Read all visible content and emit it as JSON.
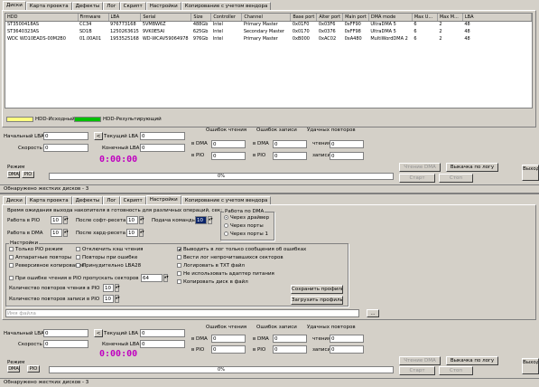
{
  "top": {
    "tabs": [
      "Диски",
      "Карта проекта",
      "Дефекты",
      "Лог",
      "Скрипт",
      "Настройки",
      "Копирование с учетом вендора"
    ],
    "table": {
      "headers": [
        "HDD",
        "Firmware",
        "LBA",
        "Serial",
        "Size",
        "Controller",
        "Channel",
        "Base port",
        "Alter port",
        "Main port",
        "DMA mode",
        "Max U...",
        "Max M...",
        "LBA"
      ],
      "rows": [
        [
          "ST3500418AS",
          "CC34",
          "976773168",
          "5VMBW6Z",
          "488Gb",
          "Intel",
          "Primary Master",
          "0x01F0",
          "0x03F6",
          "0xFF90",
          "UltraDMA 5",
          "6",
          "2",
          "48"
        ],
        [
          "ST3640323AS",
          "SD1B",
          "1250263615",
          "9VK0E5AI",
          "625Gb",
          "Intel",
          "Secondary Master",
          "0x0170",
          "0x0376",
          "0xFF98",
          "UltraDMA 5",
          "6",
          "2",
          "48"
        ],
        [
          "WDC WD10EADS-00M2B0",
          "01.00A01",
          "1953525168",
          "WD-WCAV59064978",
          "976Gb",
          "Intel",
          "Primary Master",
          "0xB000",
          "0xAC02",
          "0xA480",
          "MultiWordDMA 2",
          "6",
          "2",
          "48"
        ]
      ]
    },
    "legend": {
      "source": "HDD-Исходный",
      "result": "HDD-Результирующий",
      "source_color": "#ffff80",
      "result_color": "#00c000"
    },
    "form": {
      "start_lba_label": "Начальный LBA",
      "start_lba": "0",
      "current_lba_label": "Текущий LBA",
      "current_lba": "0",
      "speed_label": "Скорость",
      "speed": "0",
      "end_lba_label": "Конечный LBA",
      "end_lba": "0",
      "timer": "0:00:00",
      "read_errors_label": "Ошибок чтения",
      "write_errors_label": "Ошибок записи",
      "retries_label": "Удачных повторов",
      "in_dma": "в DMA",
      "in_pio": "в PIO",
      "read_label": "чтения",
      "write_label": "записи",
      "dma_read": "0",
      "pio_read": "0",
      "dma_write": "0",
      "pio_write": "0",
      "retry_read": "0",
      "retry_write": "0",
      "mode_label": "Режим",
      "dma": "DMA",
      "pio": "PIO",
      "progress": "0%",
      "read_dma_btn": "Чтение DMA",
      "start_btn": "Старт",
      "stop_btn": "Стоп",
      "log_btn": "Выкачка по логу",
      "exit_btn": "Выход"
    },
    "status": "Обнаружено жестких дисков - 3"
  },
  "bottom": {
    "tabs": [
      "Диски",
      "Карта проекта",
      "Дефекты",
      "Лог",
      "Скрипт",
      "Настройки",
      "Копирование с учетом вендора"
    ],
    "settings": {
      "timeout_label": "Время ожидания выхода накопителя в готовность для различных операций, сек:",
      "work_pio": "Работа в PIO",
      "work_pio_val": "10",
      "work_dma": "Работа в DMA",
      "work_dma_val": "10",
      "after_soft": "После софт-ресета",
      "after_soft_val": "10",
      "after_hard": "После хард-ресета",
      "after_hard_val": "10",
      "cmd_send": "Подача команды",
      "cmd_send_val": "10",
      "dma_group": "Работа по DMA",
      "radio1": "Через драйвер",
      "radio2": "Через порты",
      "radio3": "Через порты 1",
      "settings_group": "Настройки",
      "opt1": "Только PIO режим",
      "opt2": "Аппаратные повторы",
      "opt3": "Реверсивное копирование",
      "opt4": "Отключить кэш чтения",
      "opt5": "Повторы при ошибке",
      "opt6": "Принудительно LBA28",
      "opt7": "Выводить в лог только сообщения об ошибках",
      "opt8": "Вести лог непрочитавшихся секторов",
      "opt9": "Логировать в TXT файл",
      "opt10": "Не использовать адаптер питания",
      "opt11": "Копировать диск в файл",
      "skip_label": "При ошибке чтения в PIO пропускать секторов",
      "skip_val": "64",
      "read_retries": "Количество повторов чтения в PIO",
      "read_retries_val": "10",
      "write_retries": "Количество повторов записи в PIO",
      "write_retries_val": "10",
      "save_btn": "Сохранить профиль",
      "load_btn": "Загрузить профиль",
      "file_placeholder": "Имя файла",
      "browse_btn": "..."
    },
    "form": {
      "start_lba_label": "Начальный LBA",
      "start_lba": "0",
      "current_lba_label": "Текущий LBA",
      "current_lba": "0",
      "speed_label": "Скорость",
      "speed": "0",
      "end_lba_label": "Конечный LBA",
      "end_lba": "0",
      "timer": "0:00:00",
      "read_errors_label": "Ошибок чтения",
      "write_errors_label": "Ошибок записи",
      "retries_label": "Удачных повторов",
      "in_dma": "в DMA",
      "in_pio": "в PIO",
      "read_label": "чтения",
      "write_label": "записи",
      "dma_read": "0",
      "pio_read": "0",
      "dma_write": "0",
      "pio_write": "0",
      "retry_read": "0",
      "retry_write": "0",
      "mode_label": "Режим",
      "dma": "DMA",
      "pio": "PIO",
      "progress": "0%",
      "read_dma_btn": "Чтение DMA",
      "start_btn": "Старт",
      "stop_btn": "Стоп",
      "log_btn": "Выкачка по логу",
      "exit_btn": "Выход"
    },
    "status": "Обнаружено жестких дисков - 3"
  }
}
